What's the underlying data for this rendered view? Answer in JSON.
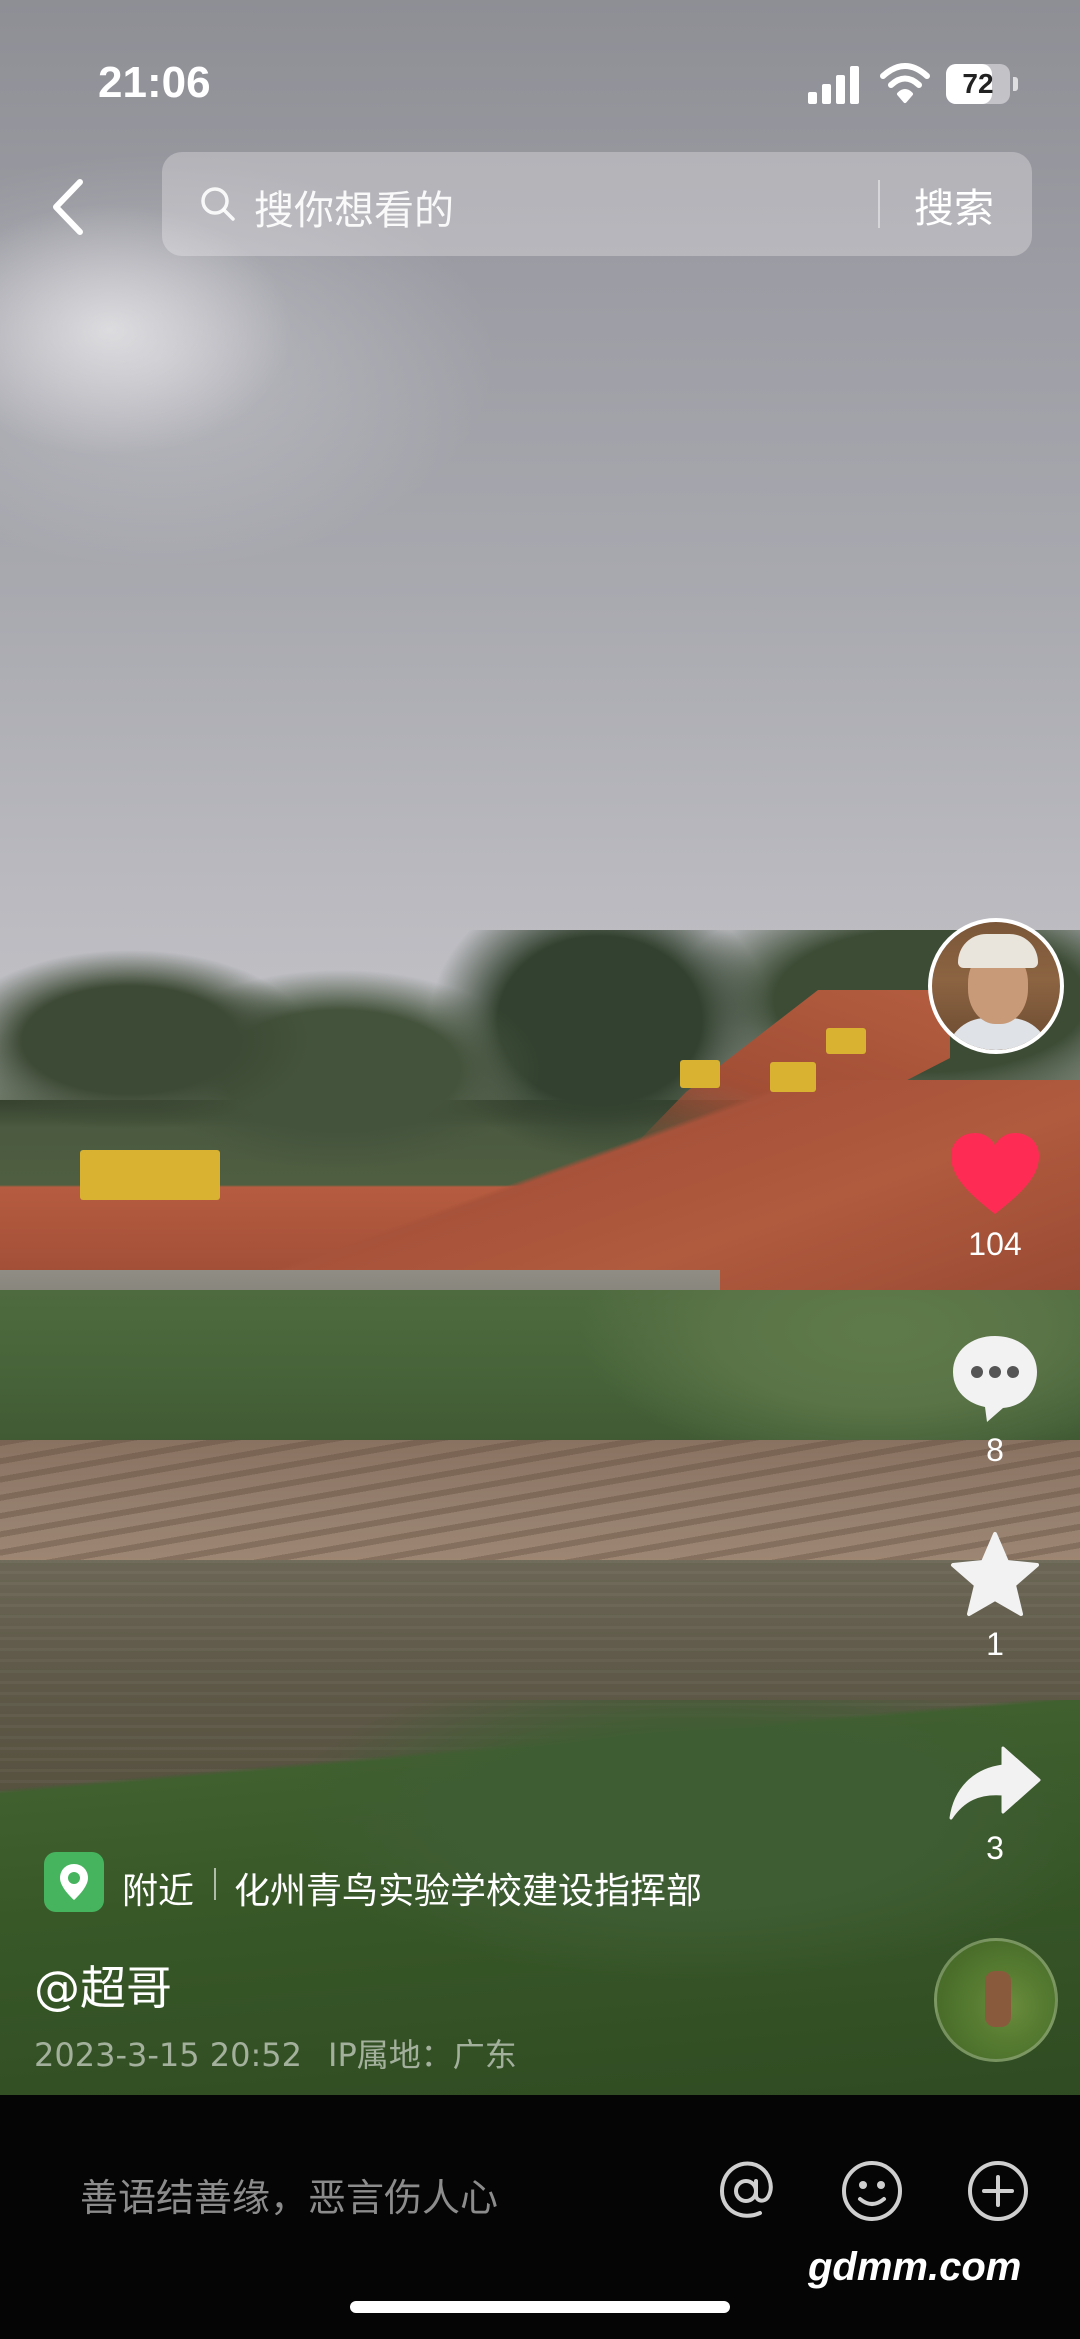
{
  "status_bar": {
    "time": "21:06",
    "battery": "72",
    "battery_level_percent": 72
  },
  "search": {
    "placeholder": "搜你想看的",
    "button_label": "搜索"
  },
  "actions": {
    "like_count": "104",
    "comment_count": "8",
    "favorite_count": "1",
    "share_count": "3",
    "like_color": "#fe2c55"
  },
  "location": {
    "nearby_label": "附近",
    "place_name": "化州青鸟实验学校建设指挥部",
    "pin_color": "#46b45e"
  },
  "post": {
    "author": "@超哥",
    "datetime": "2023-3-15 20:52",
    "ip_location": "IP属地：广东"
  },
  "comment_bar": {
    "placeholder": "善语结善缘，恶言伤人心"
  },
  "watermark": "gdmm.com"
}
